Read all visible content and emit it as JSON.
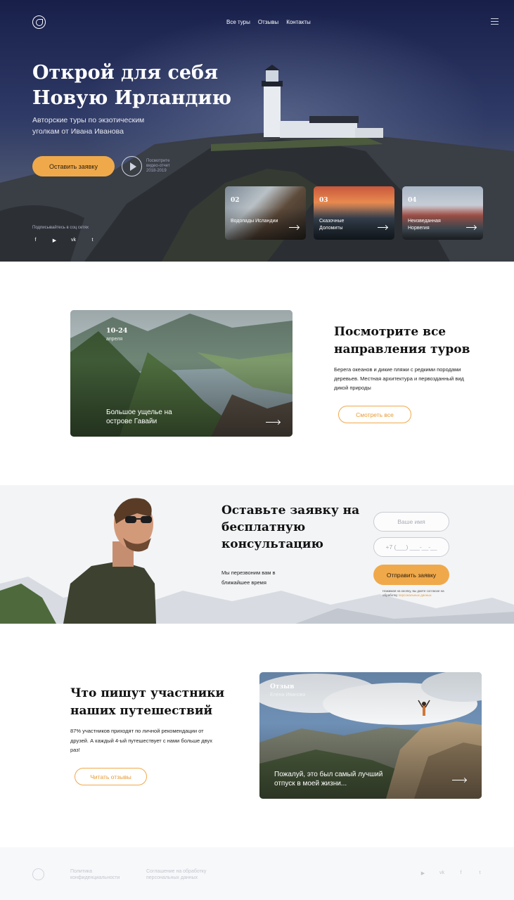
{
  "colors": {
    "accent": "#f0a94a",
    "hero_bg": "#1b2349",
    "text_dark": "#111111",
    "muted": "#c2c5cd"
  },
  "header": {
    "logo_icon": "logo-emblem-icon",
    "nav": [
      "Все туры",
      "Отзывы",
      "Контакты"
    ],
    "menu_icon": "hamburger-icon"
  },
  "hero": {
    "title_line1": "Открой для себя",
    "title_line2": "Новую Ирландию",
    "subtitle": "Авторские туры по экзотическим уголкам от Ивана Иванова",
    "cta": "Оставить заявку",
    "video_text": "Посмотрите видео-отчет 2018-2019",
    "social_label": "Подписывайтесь в соц сетях",
    "social": [
      "f",
      "▶",
      "vk",
      "t"
    ],
    "cards": [
      {
        "num": "02",
        "caption": "Водопады Исландии"
      },
      {
        "num": "03",
        "caption": "Сказочные Доломиты"
      },
      {
        "num": "04",
        "caption": "Неизведанная Норвегия"
      }
    ]
  },
  "directions": {
    "card_date": "10-24",
    "card_month": "апреля",
    "card_caption": "Большое ущелье на острове Гавайи",
    "title": "Посмотрите все направления туров",
    "text": "Берега океанов и дикие пляжи с редкими породами деревьев. Местная архитектура и первозданный вид дикой природы",
    "button": "Смотреть все"
  },
  "consult": {
    "title": "Оставьте заявку на бесплатную консультацию",
    "text": "Мы перезвоним вам в ближайшее время",
    "name_placeholder": "Ваше имя",
    "phone_placeholder": "+7 (___) ___-__-__",
    "button": "Отправить заявку",
    "consent_text": "Нажимая на кнопку, вы даете согласие на обработку",
    "consent_link": "персональных данных"
  },
  "reviews": {
    "title": "Что пишут участники наших путешествий",
    "text": "87% участников приходят по личной рекомендации от друзей. А каждый 4-ый путешествует с нами больше двух раз!",
    "button": "Читать отзывы",
    "card_label": "Отзыв",
    "card_name": "Елена Иванова",
    "card_quote": "Пожалуй, это был самый лучший отпуск в моей жизни..."
  },
  "footer": {
    "link1": "Политика конфиденциальности",
    "link2": "Соглашение на обработку персональных данных",
    "social": [
      "▶",
      "vk",
      "f",
      "t"
    ]
  }
}
